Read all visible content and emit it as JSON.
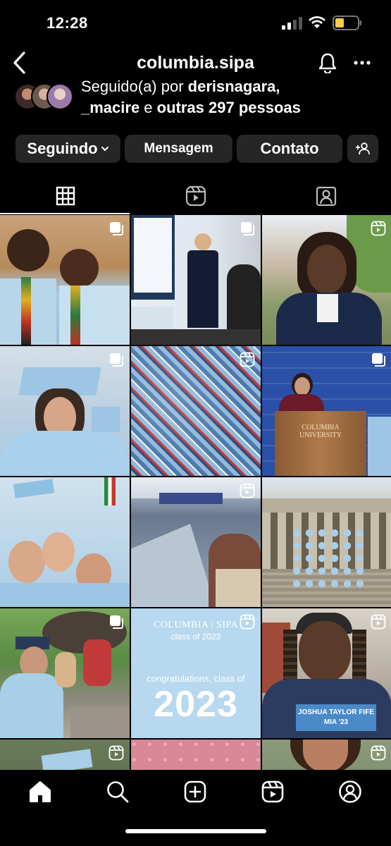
{
  "status": {
    "time": "12:28"
  },
  "header": {
    "username": "columbia.sipa"
  },
  "followed_by": {
    "prefix": "Seguido(a) por ",
    "user1": "derisnagara,",
    "user2": "_macire",
    "middle": " e ",
    "others": "outras 297 pessoas"
  },
  "buttons": {
    "following": "Seguindo",
    "message": "Mensagem",
    "contact": "Contato"
  },
  "posts": {
    "post8": {
      "brand": "COLUMBIA | SIPA",
      "subtitle": "class of 2023",
      "headline": "congratulations, class of",
      "year": "2023"
    },
    "post12": {
      "name": "JOSHUA TAYLOR FIFE",
      "degree": "MIA '23"
    },
    "post5": {
      "podium_line1": "COLUMBIA",
      "podium_line2": "UNIVERSITY"
    }
  },
  "colors": {
    "background": "#000000",
    "button_bg": "#262626",
    "columbia_blue": "#B9D9EB",
    "battery": "#F7CE46"
  }
}
